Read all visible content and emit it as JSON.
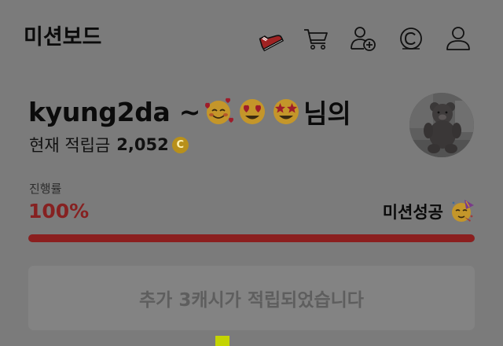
{
  "header": {
    "title": "미션보드",
    "icons": [
      "shoe-icon",
      "cart-icon",
      "add-friend-icon",
      "cash-icon",
      "profile-icon"
    ]
  },
  "greeting": {
    "name": "kyung2da ~",
    "emojis": [
      "smiling-face-with-hearts",
      "heart-eyes",
      "star-struck"
    ],
    "suffix": "님의"
  },
  "balance": {
    "label": "현재 적립금",
    "amount": "2,052",
    "coin_symbol": "C"
  },
  "progress": {
    "label": "진행률",
    "value_text": "100%",
    "fraction": 1.0,
    "status": "미션성공",
    "status_emoji": "partying-face"
  },
  "reward": {
    "message": "추가 3캐시가 적립되었습니다"
  },
  "colors": {
    "accent": "#862121",
    "progress_fill": "#8b1f1f",
    "coin": "#b8901a",
    "overlay_background": "#7b7b7b"
  }
}
